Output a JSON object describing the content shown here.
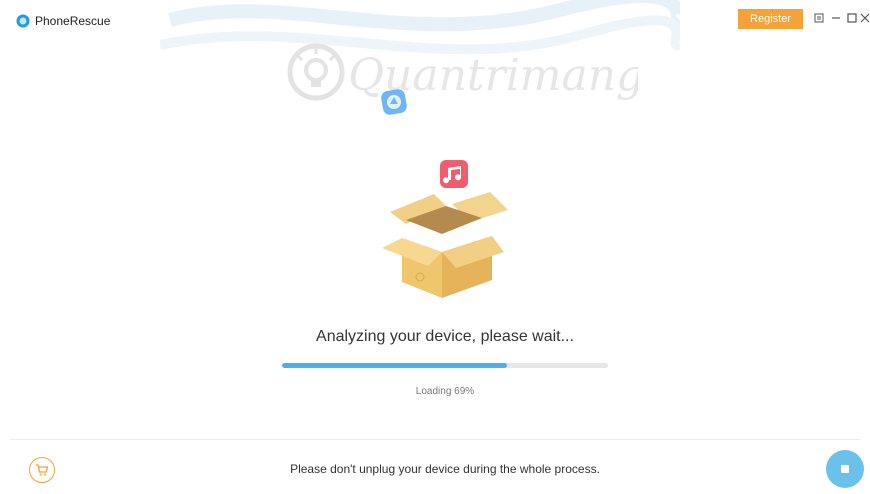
{
  "app": {
    "title": "PhoneRescue",
    "register_label": "Register",
    "window_controls": [
      "menu-icon",
      "minimize-icon",
      "maximize-icon",
      "close-icon"
    ]
  },
  "watermark": {
    "text": "Quantrimang"
  },
  "main": {
    "status": "Analyzing your device, please wait...",
    "progress_value": 69,
    "loading_label": "Loading 69%"
  },
  "footer": {
    "message": "Please don't unplug your device during the whole process.",
    "cart_icon": "cart-icon",
    "stop_icon": "stop-icon"
  },
  "colors": {
    "accent_orange": "#f6a23a",
    "progress_blue": "#4bb0e6",
    "stop_blue": "#6ac2ea"
  }
}
